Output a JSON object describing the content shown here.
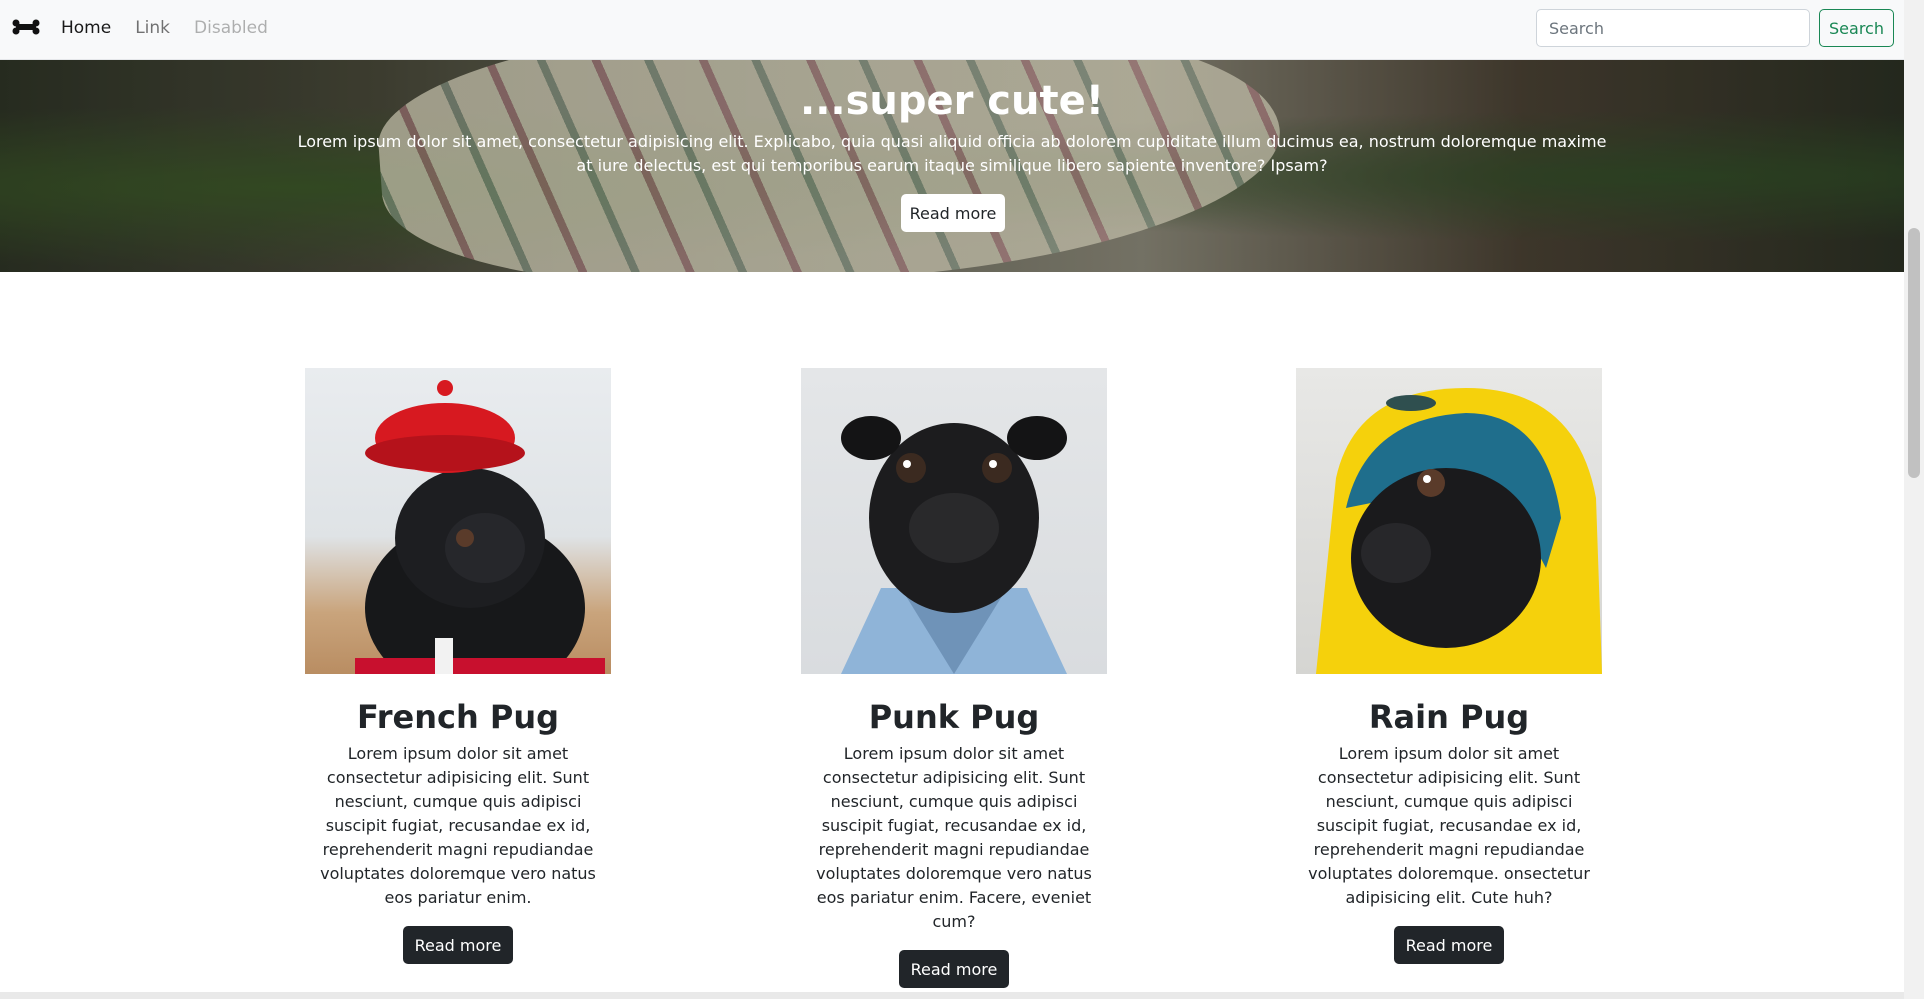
{
  "navbar": {
    "brand_icon": "bone-icon",
    "links": [
      {
        "label": "Home",
        "state": "active"
      },
      {
        "label": "Link",
        "state": "normal"
      },
      {
        "label": "Disabled",
        "state": "disabled"
      }
    ],
    "search": {
      "placeholder": "Search",
      "value": "",
      "button_label": "Search"
    },
    "colors": {
      "background": "#f8f9fa",
      "search_accent": "#198754"
    }
  },
  "hero": {
    "title": "...super cute!",
    "text": "Lorem ipsum dolor sit amet, consectetur adipisicing elit. Explicabo, quia quasi aliquid officia ab dolorem cupiditate illum ducimus ea, nostrum doloremque maxime at iure delectus, est qui temporibus earum itaque similique libero sapiente inventore? Ipsam?",
    "button_label": "Read more"
  },
  "cards": [
    {
      "title": "French Pug",
      "text": "Lorem ipsum dolor sit amet consectetur adipisicing elit. Sunt nesciunt, cumque quis adipisci suscipit fugiat, recusandae ex id, reprehenderit magni repudiandae voluptates doloremque vero natus eos pariatur enim.",
      "button_label": "Read more",
      "image": "pug-in-red-beret"
    },
    {
      "title": "Punk Pug",
      "text": "Lorem ipsum dolor sit amet consectetur adipisicing elit. Sunt nesciunt, cumque quis adipisci suscipit fugiat, recusandae ex id, reprehenderit magni repudiandae voluptates doloremque vero natus eos pariatur enim. Facere, eveniet cum?",
      "button_label": "Read more",
      "image": "pug-in-denim-jacket"
    },
    {
      "title": "Rain Pug",
      "text": "Lorem ipsum dolor sit amet consectetur adipisicing elit. Sunt nesciunt, cumque quis adipisci suscipit fugiat, recusandae ex id, reprehenderit magni repudiandae voluptates doloremque. onsectetur adipisicing elit. Cute huh?",
      "button_label": "Read more",
      "image": "pug-in-yellow-raincoat"
    }
  ]
}
